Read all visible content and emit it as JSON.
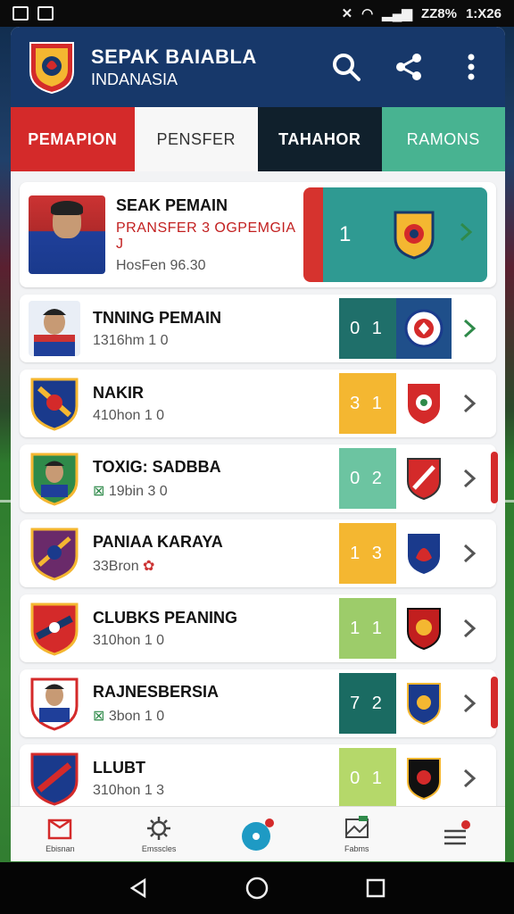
{
  "status_bar": {
    "signal_text": "ZZ8%",
    "time": "1:X26"
  },
  "header": {
    "title": "SEPAK BAIABLA",
    "subtitle": "INDANASIA"
  },
  "tabs": [
    {
      "label": "PEMAPION"
    },
    {
      "label": "PENSFER"
    },
    {
      "label": "TAHAHOR"
    },
    {
      "label": "RAMONS"
    }
  ],
  "featured": {
    "name": "SEAK PEMAIN",
    "subtitle": "PRANSFER 3 OGPEMGIA J",
    "meta": "HosFen 96.30",
    "score": "1"
  },
  "rows": [
    {
      "name": "TNNING PEMAIN",
      "meta": "1316hm 1 0",
      "score": "0 1",
      "score_color": "#1f6f6a"
    },
    {
      "name": "NAKIR",
      "meta": "410hon 1 0",
      "score": "3 1",
      "score_color": "#f4b731"
    },
    {
      "name": "TOXIG: SADBBA",
      "meta": "19bin 3 0",
      "score": "0 2",
      "score_color": "#6cc4a1"
    },
    {
      "name": "PANIAA KARAYA",
      "meta": "33Bron",
      "score": "1 3",
      "score_color": "#f4b731"
    },
    {
      "name": "CLUBKS PEANING",
      "meta": "310hon 1 0",
      "score": "1 1",
      "score_color": "#9dcc6a"
    },
    {
      "name": "RAJNESBERSIA",
      "meta": "3bon 1 0",
      "score": "7 2",
      "score_color": "#1a6b62"
    },
    {
      "name": "LLUBT",
      "meta": "310hon 1 3",
      "score": "0 1",
      "score_color": "#b5d86a"
    }
  ],
  "bottom_nav": [
    {
      "label": "Ebisnan",
      "icon": "box-icon"
    },
    {
      "label": "Emsscles",
      "icon": "gear-icon"
    },
    {
      "label": "",
      "icon": "disc-icon"
    },
    {
      "label": "Fabms",
      "icon": "map-icon"
    },
    {
      "label": "",
      "icon": "menu-icon"
    }
  ],
  "colors": {
    "header_bg": "#17386a",
    "tab_red": "#d42a2a",
    "tab_dark": "#10202c",
    "tab_teal": "#48b391",
    "accent_green": "#3aa35a"
  }
}
